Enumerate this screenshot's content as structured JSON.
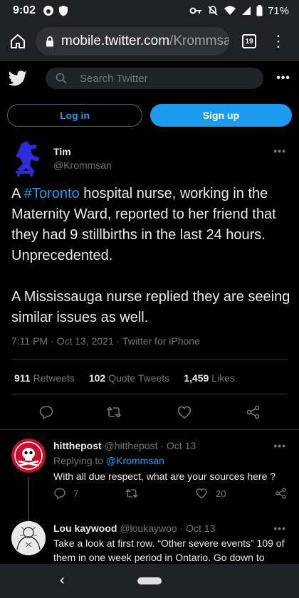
{
  "status_bar": {
    "time": "9:02",
    "battery": "71%"
  },
  "browser": {
    "url_host": "mobile.twitter.com",
    "url_path": "/Krommsan",
    "tab_count": "19"
  },
  "twitter_header": {
    "search_placeholder": "Search Twitter",
    "more_label": "•••"
  },
  "auth": {
    "login_label": "Log in",
    "signup_label": "Sign up"
  },
  "tweet": {
    "author_name": "Tim",
    "author_handle": "@Krommsan",
    "text_pre": "A ",
    "hashtag": "#Toronto",
    "text_post": " hospital nurse, working in the Maternity Ward, reported to her friend that they had 9 stillbirths in the last 24 hours.  Unprecedented.",
    "text_para2": "A Mississauga nurse replied they are seeing similar issues as well.",
    "time": "7:11 PM",
    "date": "Oct 13, 2021",
    "source": "Twitter for iPhone",
    "stats": [
      {
        "count": "911",
        "label": "Retweets"
      },
      {
        "count": "102",
        "label": "Quote Tweets"
      },
      {
        "count": "1,459",
        "label": "Likes"
      }
    ]
  },
  "replies": [
    {
      "name": "hitthepost",
      "handle": "@hitthepost",
      "date": "Oct 13",
      "replying_prefix": "Replying to ",
      "replying_to": "@Krommsan",
      "text": "With all due respect, what are your sources here ?",
      "reply_count": "7",
      "like_count": "20"
    },
    {
      "name": "Lou kaywood",
      "handle": "@loukaywoo",
      "date": "Oct 13",
      "text": "Take a look at first row. “Other severe events” 109 of them in one week period in Ontario. Go down to"
    }
  ],
  "colors": {
    "accent": "#1d9bf0",
    "background": "#000000",
    "muted": "#71767b",
    "chrome": "#202124"
  },
  "icons": [
    "twitter-bird-icon",
    "search-icon",
    "lock-icon",
    "home-icon",
    "reply-icon",
    "retweet-icon",
    "like-icon",
    "share-icon"
  ]
}
